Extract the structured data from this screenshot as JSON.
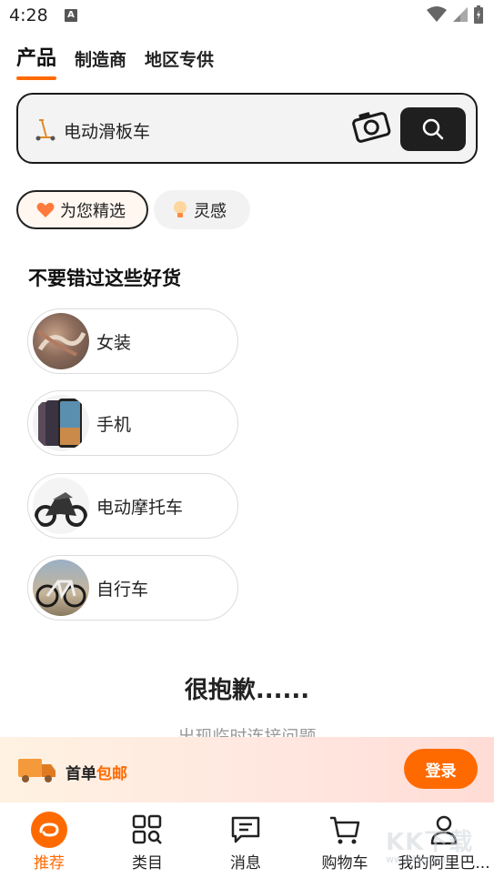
{
  "status_bar": {
    "time": "4:28",
    "notification_badge": "A"
  },
  "tabs": [
    {
      "label": "产品",
      "active": true
    },
    {
      "label": "制造商",
      "active": false
    },
    {
      "label": "地区专供",
      "active": false
    }
  ],
  "search": {
    "query": "电动滑板车",
    "icons": [
      "scooter-icon",
      "camera-icon",
      "search-icon"
    ]
  },
  "chips": [
    {
      "label": "为您精选",
      "icon": "heart-icon",
      "selected": true
    },
    {
      "label": "灵感",
      "icon": "lightbulb-icon",
      "selected": false
    }
  ],
  "section_title": "不要错过这些好货",
  "categories": [
    {
      "label": "女装"
    },
    {
      "label": "手机"
    },
    {
      "label": "电动摩托车"
    },
    {
      "label": "自行车"
    }
  ],
  "error": {
    "title": "很抱歉......",
    "subtitle": "出现临时连接问题"
  },
  "promo": {
    "text_prefix": "首单",
    "text_highlight": "包邮",
    "login_label": "登录"
  },
  "nav": [
    {
      "label": "推荐",
      "icon": "home-logo-icon",
      "active": true
    },
    {
      "label": "类目",
      "icon": "category-grid-icon",
      "active": false
    },
    {
      "label": "消息",
      "icon": "message-icon",
      "active": false
    },
    {
      "label": "购物车",
      "icon": "cart-icon",
      "active": false
    },
    {
      "label": "我的阿里巴...",
      "icon": "profile-icon",
      "active": false
    }
  ],
  "watermark": {
    "main": "KK下载",
    "url": "www.kkx.net"
  },
  "colors": {
    "accent": "#ff6a00",
    "dark": "#1f1f1f"
  }
}
